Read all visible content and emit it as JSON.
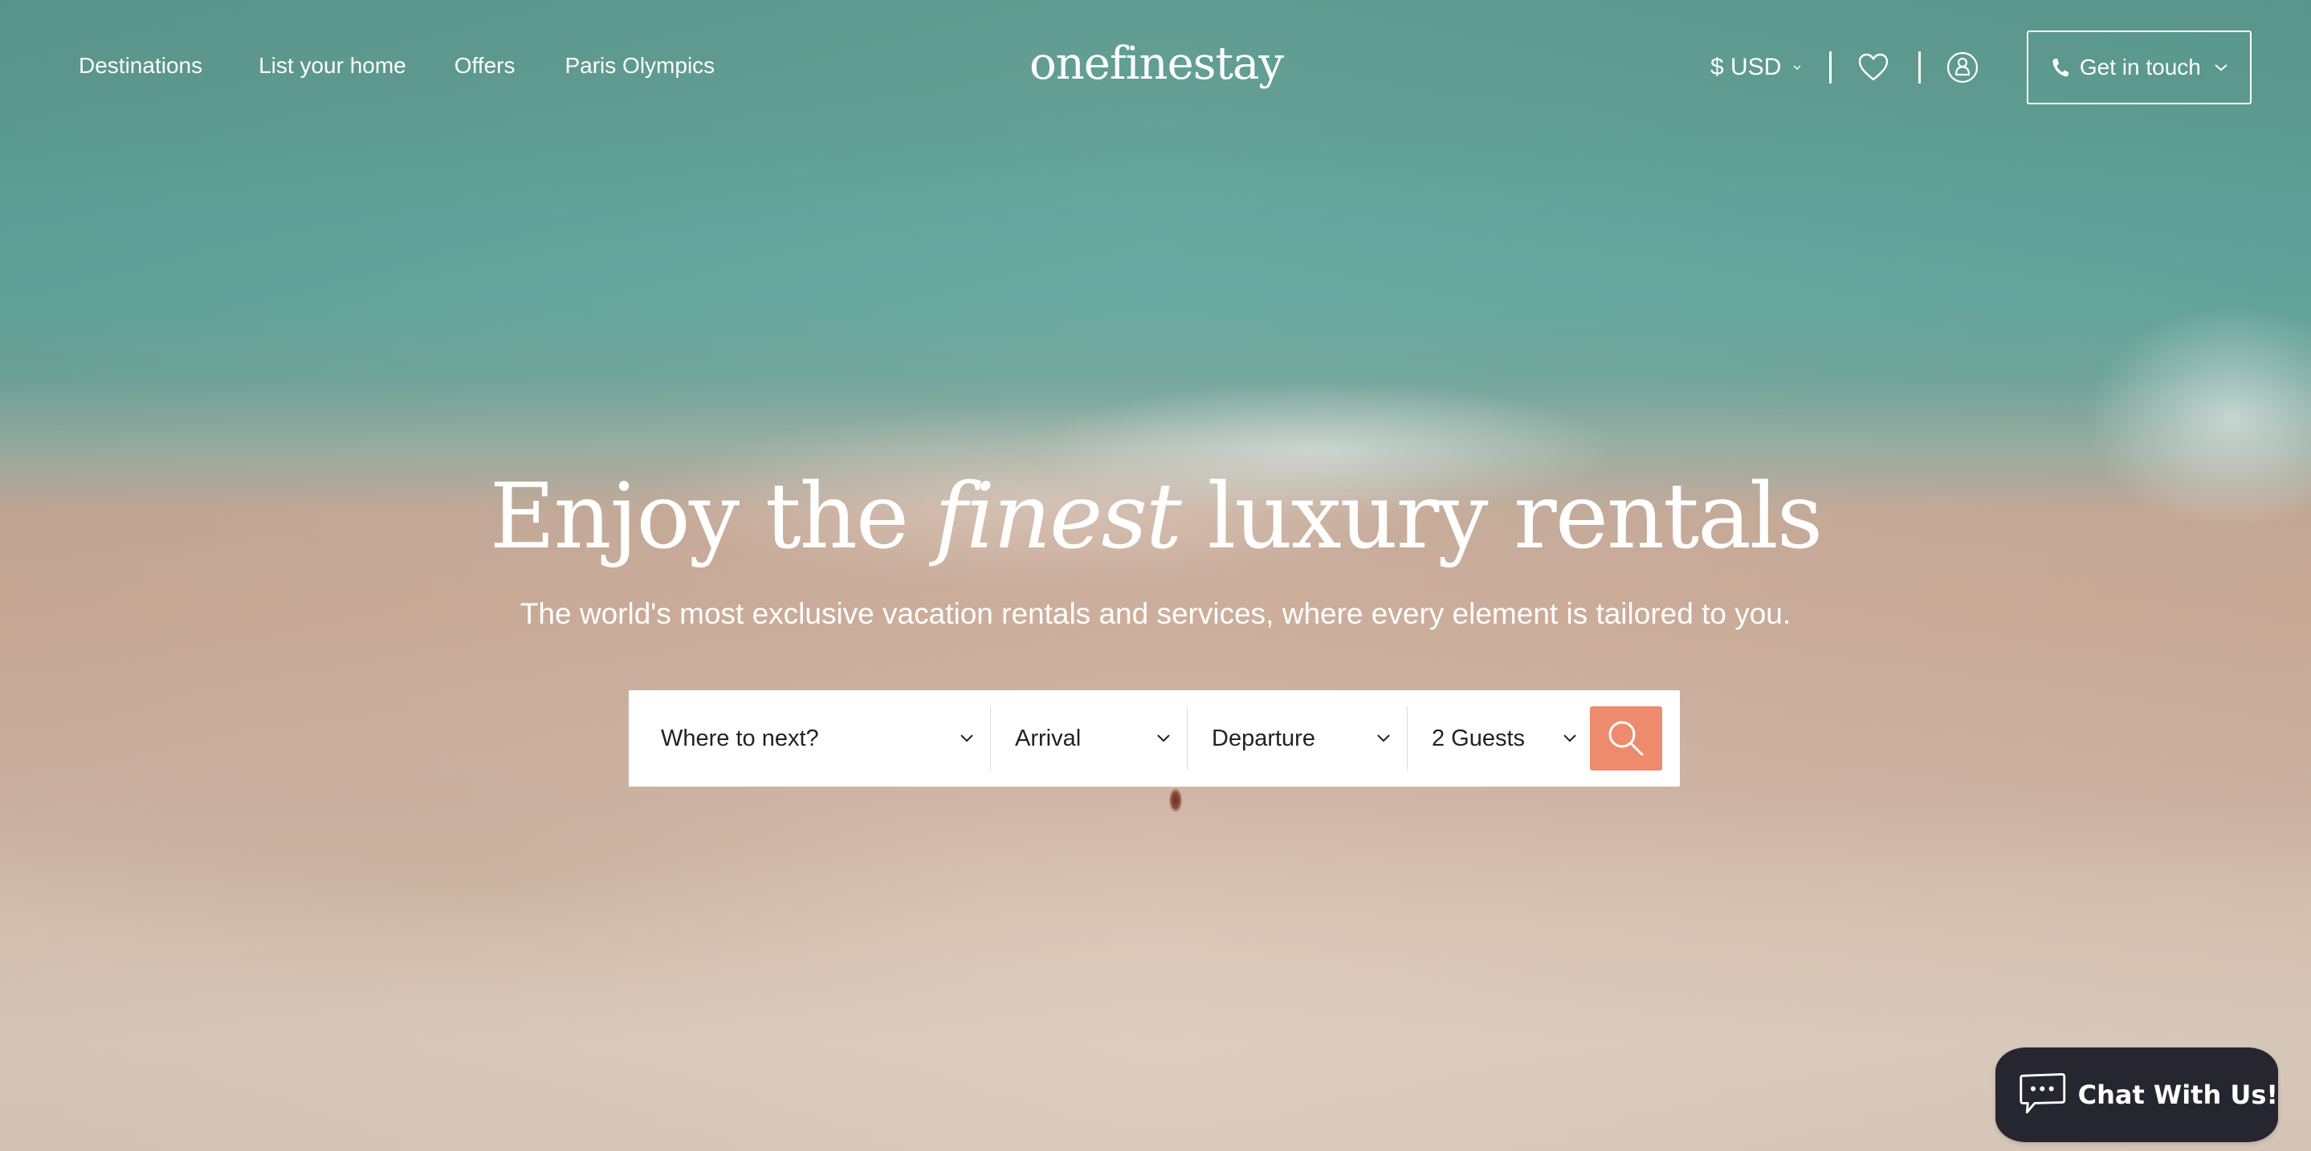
{
  "brand": {
    "logo_text": "onefinestay",
    "accent_color": "#ee8a6e",
    "chat_bg_color": "#262630"
  },
  "nav": {
    "left_links": [
      {
        "label": "Destinations"
      },
      {
        "label": "List your home"
      },
      {
        "label": "Offers"
      },
      {
        "label": "Paris Olympics"
      }
    ],
    "currency": {
      "label": "$ USD",
      "icon": "chevron-down-icon"
    },
    "wishlist_icon": "heart-icon",
    "account_icon": "user-circle-icon",
    "contact": {
      "label": "Get in touch",
      "icon": "phone-icon"
    }
  },
  "hero": {
    "title_before": "Enjoy the",
    "title_emphasis": "finest",
    "title_after": "luxury rentals",
    "subtitle": "The world's most exclusive vacation rentals and services, where every element is tailored to you."
  },
  "search": {
    "destination": {
      "placeholder": "Where to next?"
    },
    "arrival": {
      "placeholder": "Arrival"
    },
    "departure": {
      "placeholder": "Departure"
    },
    "guests": {
      "value": "2 Guests"
    },
    "search_icon": "search-icon"
  },
  "chat": {
    "label": "Chat With Us!",
    "icon": "chat-bubble-icon"
  }
}
